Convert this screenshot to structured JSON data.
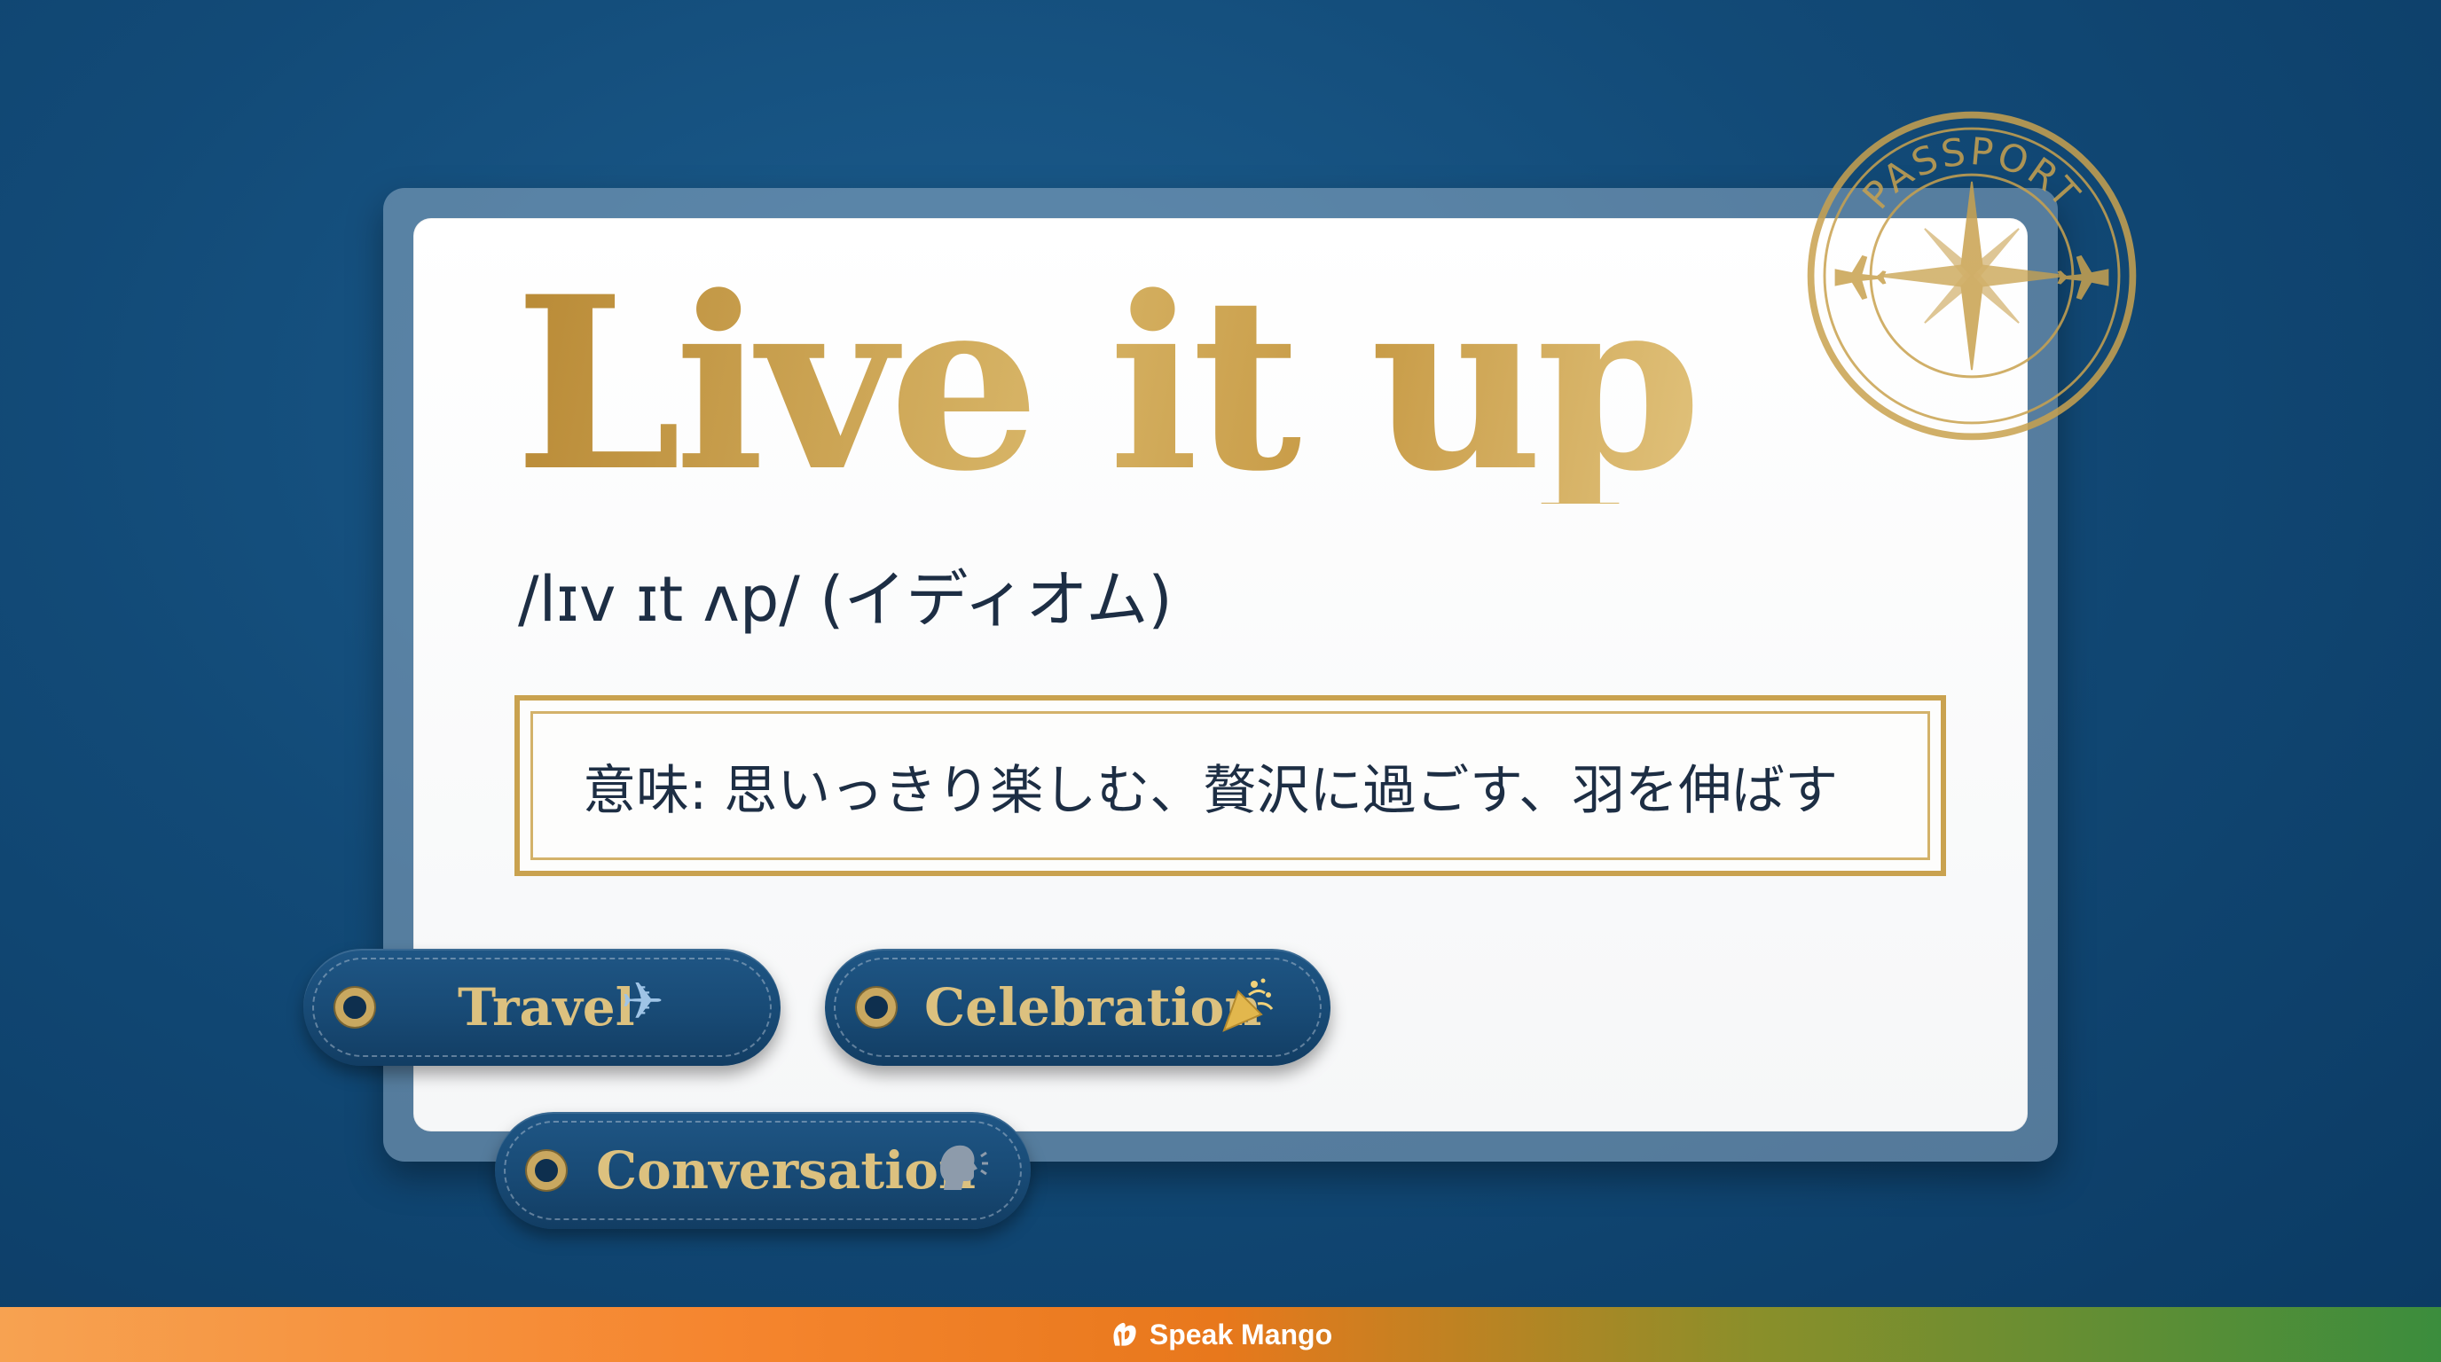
{
  "card": {
    "headword": "Live it up",
    "pronunciation": "/lɪv ɪt ʌp/ (イディオム)",
    "meaning": "意味: 思いっきり楽しむ、贅沢に過ごす、羽を伸ばす"
  },
  "tags": [
    {
      "label": "Travel",
      "icon": "airplane-icon"
    },
    {
      "label": "Celebration",
      "icon": "party-popper-icon"
    },
    {
      "label": "Conversation",
      "icon": "speaking-head-icon"
    }
  ],
  "stamp": {
    "text": "PASSPORT",
    "icons": [
      "compass-rose-icon",
      "airplane-icon"
    ]
  },
  "footer": {
    "brand": "Speak Mango",
    "logo": "mango-logo-icon"
  },
  "colors": {
    "background": "#124a77",
    "gold": "#c9a24f",
    "text": "#1d2e44",
    "tag": "#184a75"
  }
}
